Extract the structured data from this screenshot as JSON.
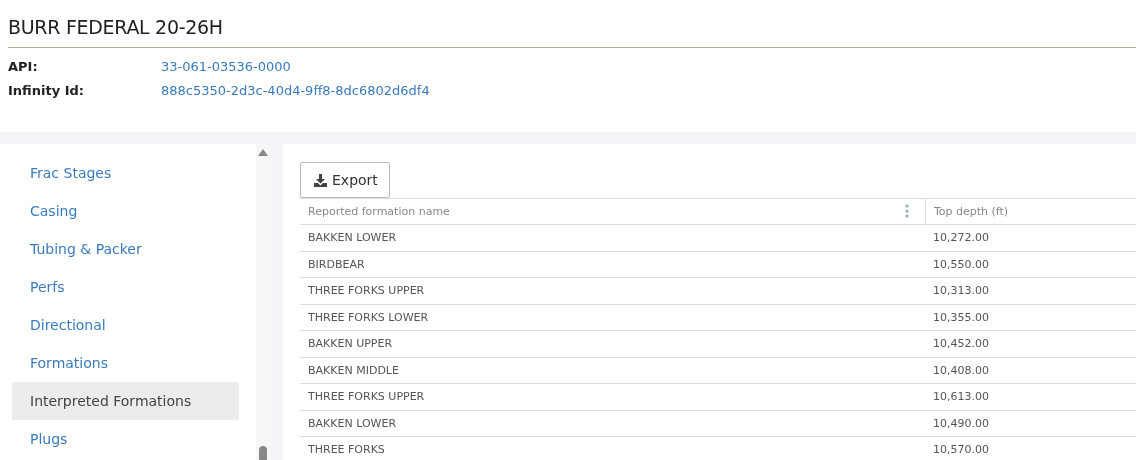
{
  "title": "BURR FEDERAL 20-26H",
  "fields": [
    {
      "label": "API:",
      "value": "33-061-03536-0000"
    },
    {
      "label": "Infinity Id:",
      "value": "888c5350-2d3c-40d4-9ff8-8dc6802d6df4"
    }
  ],
  "sidebar": {
    "items": [
      {
        "label": "Frac Stages",
        "selected": false
      },
      {
        "label": "Casing",
        "selected": false
      },
      {
        "label": "Tubing & Packer",
        "selected": false
      },
      {
        "label": "Perfs",
        "selected": false
      },
      {
        "label": "Directional",
        "selected": false
      },
      {
        "label": "Formations",
        "selected": false
      },
      {
        "label": "Interpreted Formations",
        "selected": true
      },
      {
        "label": "Plugs",
        "selected": false
      }
    ]
  },
  "export_button": "Export",
  "table": {
    "columns": [
      "Reported formation name",
      "Top depth (ft)"
    ],
    "rows": [
      [
        "BAKKEN LOWER",
        "10,272.00"
      ],
      [
        "BIRDBEAR",
        "10,550.00"
      ],
      [
        "THREE FORKS UPPER",
        "10,313.00"
      ],
      [
        "THREE FORKS LOWER",
        "10,355.00"
      ],
      [
        "BAKKEN UPPER",
        "10,452.00"
      ],
      [
        "BAKKEN MIDDLE",
        "10,408.00"
      ],
      [
        "THREE FORKS UPPER",
        "10,613.00"
      ],
      [
        "BAKKEN LOWER",
        "10,490.00"
      ],
      [
        "THREE FORKS",
        "10,570.00"
      ]
    ]
  }
}
